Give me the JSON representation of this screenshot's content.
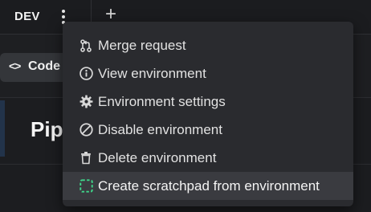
{
  "topbar": {
    "env_name": "DEV",
    "menu_icon": "kebab-menu-icon",
    "add_icon": "plus-icon",
    "add_label": "+"
  },
  "subbar": {
    "code_tab_label": "Code",
    "code_tab_icon": "code-brackets-icon"
  },
  "main": {
    "title_partial": "Pip"
  },
  "menu": {
    "items": [
      {
        "label": "Merge request",
        "icon": "merge-request-icon"
      },
      {
        "label": "View environment",
        "icon": "info-icon"
      },
      {
        "label": "Environment settings",
        "icon": "gear-icon"
      },
      {
        "label": "Disable environment",
        "icon": "disable-icon"
      },
      {
        "label": "Delete environment",
        "icon": "trash-icon"
      },
      {
        "label": "Create scratchpad from environment",
        "icon": "scratchpad-icon"
      }
    ],
    "hovered_index": 5
  },
  "colors": {
    "background": "#1d1e21",
    "menu_background": "#2a2b2f",
    "menu_hover": "#3a3b40",
    "scratchpad_accent": "#3fd68a"
  }
}
